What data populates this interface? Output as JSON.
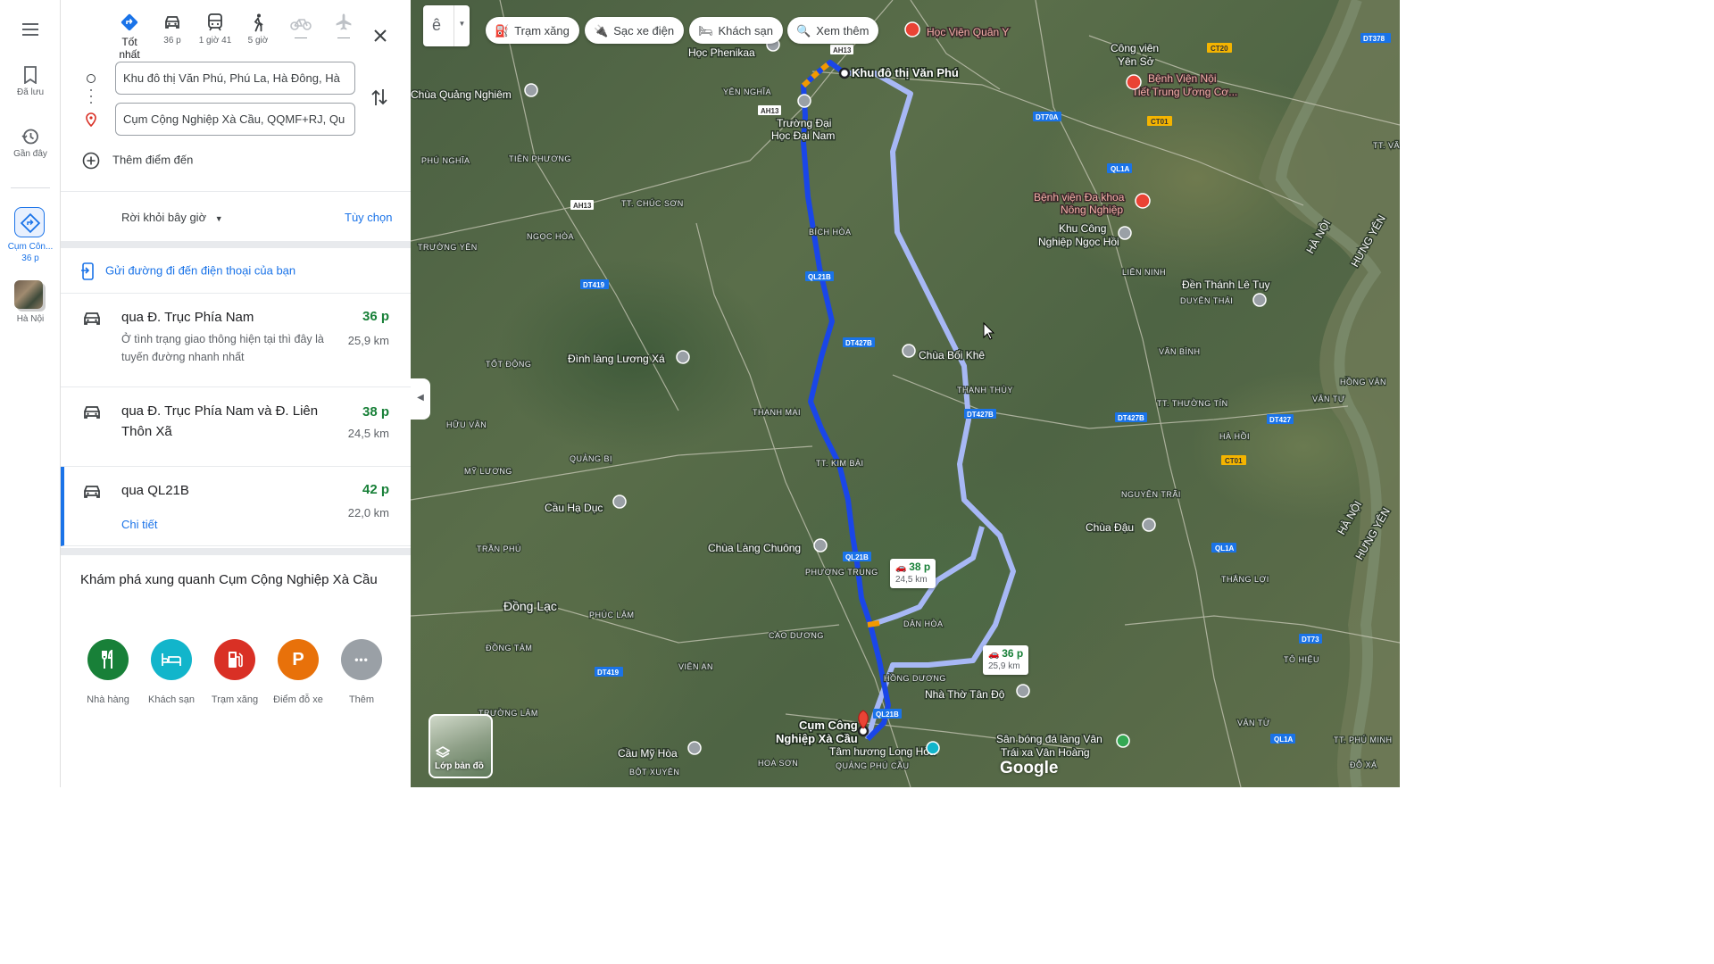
{
  "rail": {
    "saved": "Đã lưu",
    "recent": "Gần đây",
    "recent_route": "Cụm Côn...",
    "recent_route_time": "36 p",
    "hanoi": "Hà Nội"
  },
  "modes": [
    {
      "label": "Tốt nhất",
      "icon": "directions-icon"
    },
    {
      "label": "36 p",
      "icon": "car-icon"
    },
    {
      "label": "1 giờ 41",
      "icon": "transit-icon"
    },
    {
      "label": "5 giờ",
      "icon": "walk-icon"
    },
    {
      "label": "—",
      "icon": "bike-icon"
    },
    {
      "label": "—",
      "icon": "flight-icon"
    }
  ],
  "origin": "Khu đô thị Văn Phú, Phú La, Hà Đông, Hà",
  "destination": "Cụm Cộng Nghiệp Xà Cầu, QQMF+RJ, Qu",
  "add_destination": "Thêm điểm đến",
  "depart": "Rời khỏi bây giờ",
  "options": "Tùy chọn",
  "send_to_phone": "Gửi đường đi đến điện thoại của bạn",
  "routes": [
    {
      "name": "qua Đ. Trục Phía Nam",
      "time": "36 p",
      "distance": "25,9 km",
      "desc": "Ở tình trạng giao thông hiện tại thì đây là tuyến đường nhanh nhất",
      "detail": ""
    },
    {
      "name": "qua Đ. Trục Phía Nam và Đ. Liên Thôn Xã",
      "time": "38 p",
      "distance": "24,5 km",
      "desc": "",
      "detail": ""
    },
    {
      "name": "qua QL21B",
      "time": "42 p",
      "distance": "22,0 km",
      "desc": "",
      "detail": "Chi tiết"
    }
  ],
  "explore_title": "Khám phá xung quanh Cụm Cộng Nghiệp Xà Cầu",
  "categories": [
    {
      "label": "Nhà hàng",
      "color": "#188038",
      "icon": "restaurant-icon"
    },
    {
      "label": "Khách sạn",
      "color": "#12b5cb",
      "icon": "hotel-icon"
    },
    {
      "label": "Trạm xăng",
      "color": "#d93025",
      "icon": "gas-icon"
    },
    {
      "label": "Điểm đỗ xe",
      "color": "#e8710a",
      "icon": "parking-icon",
      "glyph": "P"
    },
    {
      "label": "Thêm",
      "color": "#9aa0a6",
      "icon": "more-icon",
      "glyph": "•••"
    }
  ],
  "map": {
    "lang": "ê",
    "chips": [
      "Trạm xăng",
      "Sạc xe điện",
      "Khách sạn",
      "Xem thêm"
    ],
    "layers": "Lớp bản đồ",
    "brand": "Google",
    "tip_38": {
      "time": "38 p",
      "dist": "24,5 km"
    },
    "tip_36": {
      "time": "36 p",
      "dist": "25,9 km"
    },
    "origin_label": "Khu đô thị Văn Phú",
    "dest_label_1": "Cụm Công",
    "dest_label_2": "Nghiệp Xà Cầu",
    "places": {
      "p1": "Học Phenikaa",
      "p2": "Chùa Quảng Nghiêm",
      "p3": "Trường Đại",
      "p3b": "Học Đại Nam",
      "p4": "Học Viện Quân Y",
      "p5": "Công viên",
      "p5b": "Yên Sở",
      "p6": "Bệnh Viện Nội",
      "p6b": "Tiết Trung Ương Cơ...",
      "p7": "Bệnh viện Đa khoa",
      "p7b": "Nông Nghiệp",
      "p8": "Khu Công",
      "p8b": "Nghiệp Ngọc Hồi",
      "p9": "Đền Thánh Lê Tuy",
      "p10": "Đình làng Lương Xá",
      "p11": "Chùa Bối Khê",
      "p12": "Cầu Hạ Dục",
      "p13": "Chùa Làng Chuông",
      "p14": "Chùa Đậu",
      "p15": "Đồng Lạc",
      "p16": "Nhà Thờ Tân Độ",
      "p17": "Tâm hương Long Hòa",
      "p18": "Cầu Mỹ Hòa",
      "p19": "Sân bóng đá làng Vân",
      "p19b": "Trái xa Vân Hoàng"
    },
    "areas": {
      "a1": "YÊN NGHĨA",
      "a2": "PHÚ NGHĨA",
      "a3": "TIÊN PHƯƠNG",
      "a4": "TT. CHÚC SƠN",
      "a5": "NGỌC HÒA",
      "a6": "TRƯỜNG YÊN",
      "a7": "BÍCH HÒA",
      "a8": "LIÊN NINH",
      "a9": "DUYÊN THÁI",
      "a10": "TỐT ĐỘNG",
      "a11": "THANH THÙY",
      "a12": "VĂN BÌNH",
      "a13": "THANH MAI",
      "a14": "HỮU VĂN",
      "a15": "TT. KIM BÀI",
      "a16": "TT. THƯỜNG TÍN",
      "a17": "VĂN TỰ",
      "a18": "HÀ HỒI",
      "a19": "QUẢNG BỊ",
      "a20": "MỸ LƯƠNG",
      "a21": "NGUYÊN TRÃI",
      "a22": "TRẦN PHÚ",
      "a23": "PHƯƠNG TRUNG",
      "a24": "THẮNG LỢI",
      "a25": "PHÚC LÂM",
      "a26": "DÂN HÒA",
      "a27": "CAO DƯƠNG",
      "a28": "ĐỒNG TÂM",
      "a29": "VIÊN AN",
      "a30": "TÔ HIỆU",
      "a31": "HỒNG DƯƠNG",
      "a32": "TRƯỜNG LÂM",
      "a33": "VÂN TỪ",
      "a34": "HOA SƠN",
      "a35": "BỘT XUYÊN",
      "a36": "QUẢNG PHÚ CẦU",
      "a37": "TT. PHÚ MINH",
      "a38": "ĐỖ XÁ",
      "a39": "HỒNG VÂN",
      "a40": "TT. VĂN",
      "a41": "HÀ NỘI",
      "a42": "HƯNG YÊN"
    },
    "roads": [
      "AH13",
      "DT70A",
      "QL1A",
      "CT01",
      "CT20",
      "QL21B",
      "DT427B",
      "DT419",
      "DT427",
      "DT73",
      "DT378"
    ]
  }
}
